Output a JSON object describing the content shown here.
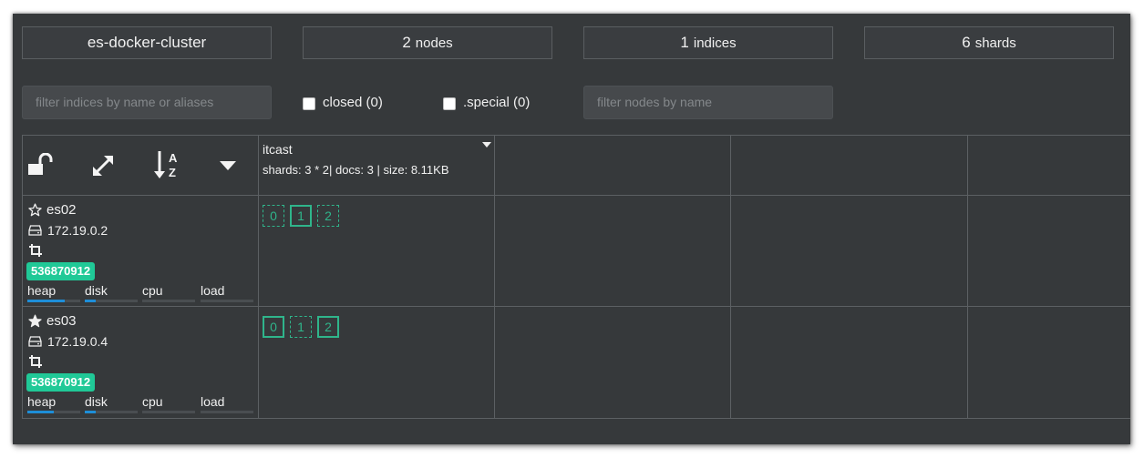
{
  "cluster": {
    "name": "es-docker-cluster",
    "nodes_count": "2",
    "nodes_label": "nodes",
    "indices_count": "1",
    "indices_label": "indices",
    "shards_count": "6",
    "shards_label": "shards"
  },
  "filters": {
    "indices_placeholder": "filter indices by name or aliases",
    "closed_label": "closed (0)",
    "special_label": ".special (0)",
    "nodes_placeholder": "filter nodes by name"
  },
  "toolbar": {
    "icons": [
      "unlock-icon",
      "expand-icon",
      "sort-az-icon",
      "caret-down-icon"
    ]
  },
  "index": {
    "name": "itcast",
    "meta": "shards: 3 * 2| docs: 3 | size: 8.11KB"
  },
  "nodes": [
    {
      "name": "es02",
      "master": false,
      "ip": "172.19.0.2",
      "badge": "536870912",
      "metrics": [
        {
          "label": "heap",
          "fill": 0.7
        },
        {
          "label": "disk",
          "fill": 0.2
        },
        {
          "label": "cpu",
          "fill": 0
        },
        {
          "label": "load",
          "fill": 0
        }
      ],
      "shards": [
        {
          "label": "0",
          "primary": false
        },
        {
          "label": "1",
          "primary": true
        },
        {
          "label": "2",
          "primary": false
        }
      ]
    },
    {
      "name": "es03",
      "master": true,
      "ip": "172.19.0.4",
      "badge": "536870912",
      "metrics": [
        {
          "label": "heap",
          "fill": 0.5
        },
        {
          "label": "disk",
          "fill": 0.2
        },
        {
          "label": "cpu",
          "fill": 0
        },
        {
          "label": "load",
          "fill": 0
        }
      ],
      "shards": [
        {
          "label": "0",
          "primary": true
        },
        {
          "label": "1",
          "primary": false
        },
        {
          "label": "2",
          "primary": true
        }
      ]
    }
  ],
  "colors": {
    "background": "#36393b",
    "badge": "#20c997",
    "shard": "#2fb58b",
    "metric_fill": "#1e8ed8"
  }
}
